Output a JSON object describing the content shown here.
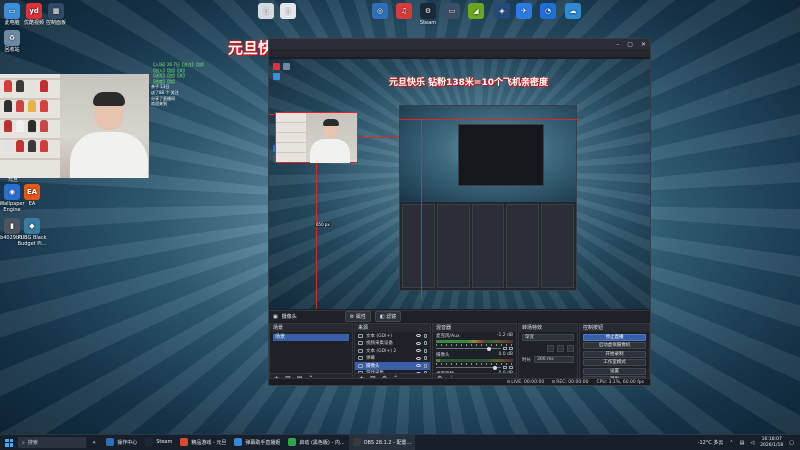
{
  "colors": {
    "accent_red": "#e32424",
    "obs_selection": "#3a5ea8",
    "obs_bg": "#1c1e24",
    "taskbar": "#17202a"
  },
  "stream_title": "元旦快乐 钻粉138米=10个飞机亲密度",
  "desktop_icons_left": [
    {
      "label": "此电脑",
      "icon": "computer-icon",
      "color": "#3d8fd8",
      "glyph": "▭"
    },
    {
      "label": "优酷视频",
      "icon": "youku-icon",
      "color": "#e0303a",
      "glyph": "yd"
    },
    {
      "label": "控制面板",
      "icon": "control-panel-icon",
      "color": "#334a66",
      "glyph": "▦"
    },
    {
      "label": "回收站",
      "icon": "recycle-bin-icon",
      "color": "#6e8aa3",
      "glyph": "♻"
    },
    {
      "label": "Wallpaper Engine",
      "icon": "wallpaper-engine-icon",
      "color": "#2a6fd0",
      "glyph": "◉"
    },
    {
      "label": "EA",
      "icon": "ea-icon",
      "color": "#e8571a",
      "glyph": "EA"
    },
    {
      "label": "7b4029b0...",
      "icon": "file-icon",
      "color": "#4d5560",
      "glyph": "▮"
    },
    {
      "label": "PUBG Black Budget Pl...",
      "icon": "pubg-icon",
      "color": "#3a7aa0",
      "glyph": "◆"
    }
  ],
  "desktop_icons_top": [
    {
      "label": "",
      "icon": "file-icon",
      "color": "#d6dbe2",
      "glyph": "▯"
    },
    {
      "label": "",
      "icon": "document-icon",
      "color": "#e2e6ea",
      "glyph": "▯"
    },
    {
      "label": "",
      "icon": "app-icon",
      "color": "#2f6fb8",
      "glyph": "◎"
    },
    {
      "label": "",
      "icon": "netease-music-icon",
      "color": "#d73a3a",
      "glyph": "♫"
    },
    {
      "label": "Steam",
      "icon": "steam-icon",
      "color": "#1b2838",
      "glyph": "⚙"
    },
    {
      "label": "",
      "icon": "monitor-icon",
      "color": "#3b4f64",
      "glyph": "▭"
    },
    {
      "label": "",
      "icon": "nvidia-icon",
      "color": "#6aa81e",
      "glyph": "◢"
    },
    {
      "label": "",
      "icon": "game-icon",
      "color": "#234a7a",
      "glyph": "◈"
    },
    {
      "label": "",
      "icon": "feishu-icon",
      "color": "#2c7be5",
      "glyph": "✈"
    },
    {
      "label": "",
      "icon": "qq-icon",
      "color": "#1e6fd8",
      "glyph": "◔"
    },
    {
      "label": "",
      "icon": "network-icon",
      "color": "#2f8ad0",
      "glyph": "☁"
    }
  ],
  "chat_lines": [
    "【入场】26 7日【关注】【加】",
    "【加入】【加】【关】",
    "【送礼】【加】【关】",
    "【热度】【加】",
    "",
    "亲子 13日",
    "",
    "送了88 个 关注",
    "分享了直播间",
    "",
    "欢迎来到"
  ],
  "webcam_label": "元旦",
  "obs": {
    "preview_label": "650 px",
    "context_bar": {
      "source_name": "摄像头",
      "properties_label": "属性",
      "filters_label": "滤镜"
    },
    "docks": {
      "scenes": {
        "title": "场景",
        "items": [
          "场景"
        ]
      },
      "sources": {
        "title": "来源",
        "items": [
          {
            "name": "文本 (GDI+)",
            "selected": false
          },
          {
            "name": "视频采集设备",
            "selected": false
          },
          {
            "name": "文本 (GDI+) 2",
            "selected": false
          },
          {
            "name": "弹幕",
            "selected": false
          },
          {
            "name": "摄像头",
            "selected": true
          },
          {
            "name": "游戏采集",
            "selected": false
          },
          {
            "name": "显示器采集",
            "selected": false
          }
        ]
      },
      "mixer": {
        "title": "混音器",
        "channels": [
          {
            "name": "麦克风/Aux",
            "db": "-1.2 dB",
            "level": 0.62,
            "volume": 0.82
          },
          {
            "name": "摄像头",
            "db": "0.0 dB",
            "level": 0.05,
            "volume": 0.9
          },
          {
            "name": "桌面音频",
            "db": "0.0 dB",
            "level": 0.45,
            "volume": 0.85
          }
        ]
      },
      "transitions": {
        "title": "转场特效",
        "type": "渐变",
        "duration_label": "时长",
        "duration": "300 ms"
      },
      "controls": {
        "title": "控制按钮",
        "buttons": [
          {
            "label": "停止直播",
            "primary": true
          },
          {
            "label": "启动虚拟摄像机",
            "primary": false
          },
          {
            "label": "开始录制",
            "primary": false
          },
          {
            "label": "工作室模式",
            "primary": false
          },
          {
            "label": "设置",
            "primary": false
          },
          {
            "label": "退出",
            "primary": false
          }
        ]
      }
    },
    "status": {
      "live": "LIVE: 00:00:00",
      "rec": "REC: 00:00:00",
      "cpu": "CPU: 3.1%, 60.00 fps"
    }
  },
  "taskbar": {
    "search_placeholder": "搜索",
    "items": [
      {
        "label": "操作中心",
        "icon": "action-center-icon",
        "color": "#2f6fb8",
        "active": false
      },
      {
        "label": "Steam",
        "icon": "steam-icon",
        "color": "#1b2838",
        "active": false
      },
      {
        "label": "精品游戏 - 元旦",
        "icon": "browser-icon",
        "color": "#d84a2a",
        "active": false
      },
      {
        "label": "弹幕助手直播姬",
        "icon": "danmaku-icon",
        "color": "#3a86d8",
        "active": false
      },
      {
        "label": "启动 (黑色版) - 内...",
        "icon": "launcher-icon",
        "color": "#2aa84a",
        "active": false
      },
      {
        "label": "OBS 28.1.2 - 配置...",
        "icon": "obs-icon",
        "color": "#3a3a3a",
        "active": true
      }
    ],
    "weather": "-12°C 多云",
    "time": "16:18:07",
    "date": "2026/1/18"
  }
}
